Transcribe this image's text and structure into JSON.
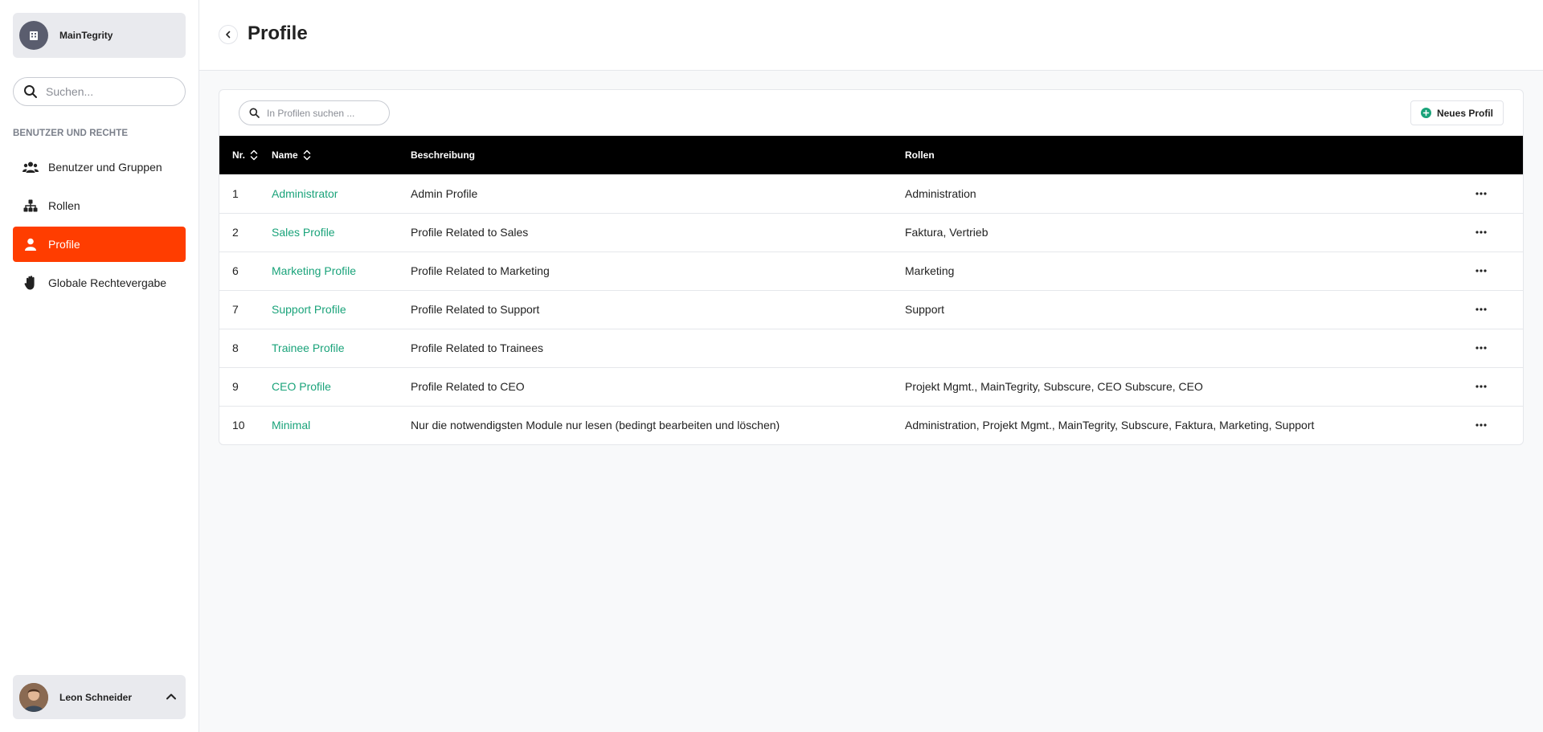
{
  "org": {
    "name": "MainTegrity"
  },
  "sidebar": {
    "search_placeholder": "Suchen...",
    "section_title": "BENUTZER UND RECHTE",
    "items": [
      {
        "label": "Benutzer und Gruppen",
        "icon": "users-icon",
        "active": false
      },
      {
        "label": "Rollen",
        "icon": "hierarchy-icon",
        "active": false
      },
      {
        "label": "Profile",
        "icon": "person-icon",
        "active": true
      },
      {
        "label": "Globale Rechtevergabe",
        "icon": "hand-icon",
        "active": false
      }
    ]
  },
  "user": {
    "name": "Leon Schneider"
  },
  "header": {
    "title": "Profile"
  },
  "toolbar": {
    "search_placeholder": "In Profilen suchen ...",
    "new_label": "Neues Profil"
  },
  "table": {
    "columns": {
      "nr": "Nr.",
      "name": "Name",
      "description": "Beschreibung",
      "roles": "Rollen"
    },
    "rows": [
      {
        "nr": "1",
        "name": "Administrator",
        "description": "Admin Profile",
        "roles": "Administration"
      },
      {
        "nr": "2",
        "name": "Sales Profile",
        "description": "Profile Related to Sales",
        "roles": "Faktura, Vertrieb"
      },
      {
        "nr": "6",
        "name": "Marketing Profile",
        "description": "Profile Related to Marketing",
        "roles": "Marketing"
      },
      {
        "nr": "7",
        "name": "Support Profile",
        "description": "Profile Related to Support",
        "roles": "Support"
      },
      {
        "nr": "8",
        "name": "Trainee Profile",
        "description": "Profile Related to Trainees",
        "roles": ""
      },
      {
        "nr": "9",
        "name": "CEO Profile",
        "description": "Profile Related to CEO",
        "roles": "Projekt Mgmt., MainTegrity, Subscure, CEO Subscure, CEO"
      },
      {
        "nr": "10",
        "name": "Minimal",
        "description": "Nur die notwendigsten Module nur lesen (bedingt bearbeiten und löschen)",
        "roles": "Administration, Projekt Mgmt., MainTegrity, Subscure, Faktura, Marketing, Support"
      }
    ]
  },
  "colors": {
    "accent": "#ff3d00",
    "link": "#1aa37a",
    "table_header": "#000000"
  }
}
